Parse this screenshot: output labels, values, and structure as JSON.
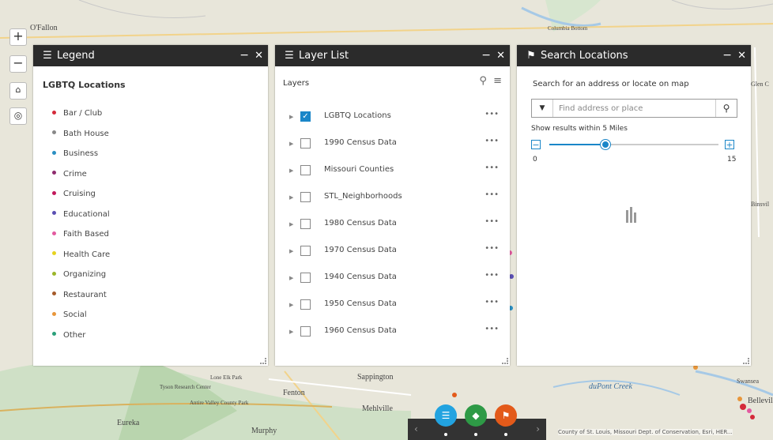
{
  "map": {
    "labels": [
      "O'Fallon",
      "Columbia Bottom",
      "Sappington",
      "Fenton",
      "Lone Elk Park",
      "Tyson Research Center",
      "Antire Valley County Park",
      "Eureka",
      "Murphy",
      "Mehlville",
      "duPont Creek",
      "Swansea",
      "Belleville",
      "Glen C",
      "Binsvil"
    ],
    "attribution": "County of St. Louis, Missouri Dept. of Conservation, Esri, HER..."
  },
  "zoom": {
    "in_label": "+",
    "out_label": "−",
    "home_icon": "home-icon",
    "locate_icon": "locate-icon"
  },
  "legend": {
    "header": "Legend",
    "section_title": "LGBTQ Locations",
    "items": [
      {
        "label": "Bar / Club",
        "color": "#d42a3a"
      },
      {
        "label": "Bath House",
        "color": "#888888"
      },
      {
        "label": "Business",
        "color": "#2a8fc2"
      },
      {
        "label": "Crime",
        "color": "#8e2b6e"
      },
      {
        "label": "Cruising",
        "color": "#c2185b"
      },
      {
        "label": "Educational",
        "color": "#5a4fb3"
      },
      {
        "label": "Faith Based",
        "color": "#e35aa0"
      },
      {
        "label": "Health Care",
        "color": "#e6d31f"
      },
      {
        "label": "Organizing",
        "color": "#9bb62a"
      },
      {
        "label": "Restaurant",
        "color": "#a55a2a"
      },
      {
        "label": "Social",
        "color": "#e8963a"
      },
      {
        "label": "Other",
        "color": "#2aa07a"
      }
    ]
  },
  "layer_list": {
    "header": "Layer List",
    "section": "Layers",
    "layers": [
      {
        "name": "LGBTQ Locations",
        "checked": true
      },
      {
        "name": "1990 Census Data",
        "checked": false
      },
      {
        "name": "Missouri Counties",
        "checked": false
      },
      {
        "name": "STL_Neighborhoods",
        "checked": false
      },
      {
        "name": "1980 Census Data",
        "checked": false
      },
      {
        "name": "1970 Census Data",
        "checked": false
      },
      {
        "name": "1940 Census Data",
        "checked": false
      },
      {
        "name": "1950 Census Data",
        "checked": false
      },
      {
        "name": "1960 Census Data",
        "checked": false
      }
    ],
    "options_label": "•••"
  },
  "search": {
    "header": "Search Locations",
    "prompt": "Search for an address or locate on map",
    "placeholder": "Find address or place",
    "within_label": "Show results within 5 Miles",
    "slider_min": "0",
    "slider_max": "15",
    "slider_value": 5,
    "slider_range": [
      0,
      15
    ]
  },
  "panel_controls": {
    "minimize": "−",
    "close": "✕"
  },
  "dock": {
    "prev": "‹",
    "next": "›"
  },
  "colors": {
    "accent": "#1a86c8",
    "legend_btn": "#22a3e0",
    "layers_btn": "#2e9a46",
    "search_btn": "#e35a1a",
    "header": "#2b2b2b"
  }
}
